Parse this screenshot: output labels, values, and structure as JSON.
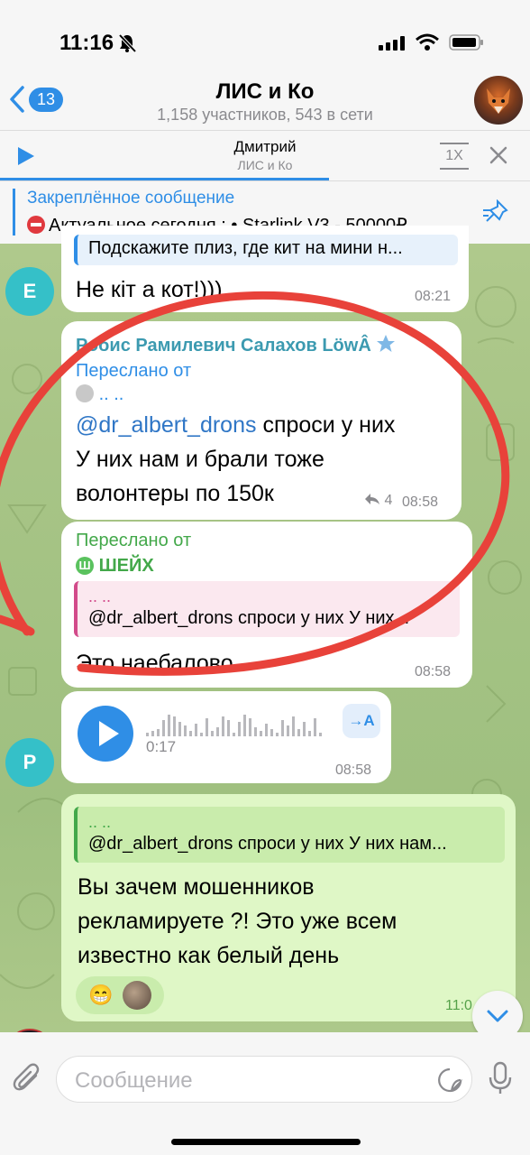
{
  "status": {
    "time": "11:16"
  },
  "header": {
    "back_count": "13",
    "title": "ЛИС и Ко",
    "subtitle": "1,158 участников, 543 в сети"
  },
  "player": {
    "name": "Дмитрий",
    "chat": "ЛИС и Ко",
    "speed": "1X",
    "progress": 0.62
  },
  "pinned": {
    "title": "Закреплённое сообщение",
    "text": "Актуальное сегодня : • Starlink V3 - 50000₽..."
  },
  "messages": [
    {
      "reply_preview": "Подскажите плиз, где кит на мини н...",
      "text": "Не кіт а кот!)))",
      "time": "08:21",
      "avatar_letter": "E",
      "avatar_color": "#35c0c8"
    },
    {
      "sender": "Робис Рамилевич Салахов LöwÂ",
      "forwarded_label": "Переслано от",
      "forwarded_from": ".. ..",
      "mention": "@dr_albert_drons",
      "text_after_mention": " спроси у них",
      "text_lines": [
        "У них нам и брали тоже",
        "волонтеры по 150к"
      ],
      "replies": "4",
      "time": "08:58"
    },
    {
      "forwarded_label": "Переслано от",
      "forwarded_from": "ШЕЙХ",
      "forwarded_avatar": "Ш",
      "reply_dots": ".. ..",
      "reply_text": "@dr_albert_drons спроси у них У них...",
      "text": "Это наебалово",
      "time": "08:58"
    },
    {
      "duration": "0:17",
      "transcribe": "→A",
      "time": "08:58",
      "avatar_letter": "P",
      "avatar_color": "#35c0c8"
    },
    {
      "reply_dots": ".. ..",
      "reply_text": "@dr_albert_drons спроси у них У них нам...",
      "text_lines": [
        "Вы зачем мошенников",
        "рекламируете ?! Это уже всем",
        "известно как белый день"
      ],
      "reaction": "😁",
      "time": "11:0"
    }
  ],
  "composer": {
    "placeholder": "Сообщение"
  },
  "colors": {
    "accent": "#2f8ee6",
    "outgoing": "#dff7c6",
    "annotation": "#e8423a"
  }
}
